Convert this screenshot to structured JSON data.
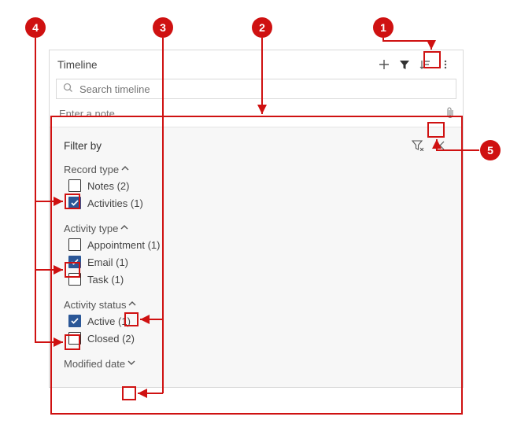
{
  "header": {
    "title": "Timeline"
  },
  "search": {
    "placeholder": "Search timeline"
  },
  "note": {
    "placeholder": "Enter a note..."
  },
  "filter": {
    "title": "Filter by",
    "sections": [
      {
        "label": "Record type",
        "expanded": true,
        "options": [
          {
            "label": "Notes (2)",
            "checked": false
          },
          {
            "label": "Activities (1)",
            "checked": true
          }
        ]
      },
      {
        "label": "Activity type",
        "expanded": true,
        "options": [
          {
            "label": "Appointment (1)",
            "checked": false
          },
          {
            "label": "Email (1)",
            "checked": true
          },
          {
            "label": "Task (1)",
            "checked": false
          }
        ]
      },
      {
        "label": "Activity status",
        "expanded": true,
        "options": [
          {
            "label": "Active (1)",
            "checked": true
          },
          {
            "label": "Closed (2)",
            "checked": false
          }
        ]
      },
      {
        "label": "Modified date",
        "expanded": false,
        "options": []
      }
    ]
  },
  "callouts": {
    "c1": "1",
    "c2": "2",
    "c3": "3",
    "c4": "4",
    "c5": "5"
  }
}
